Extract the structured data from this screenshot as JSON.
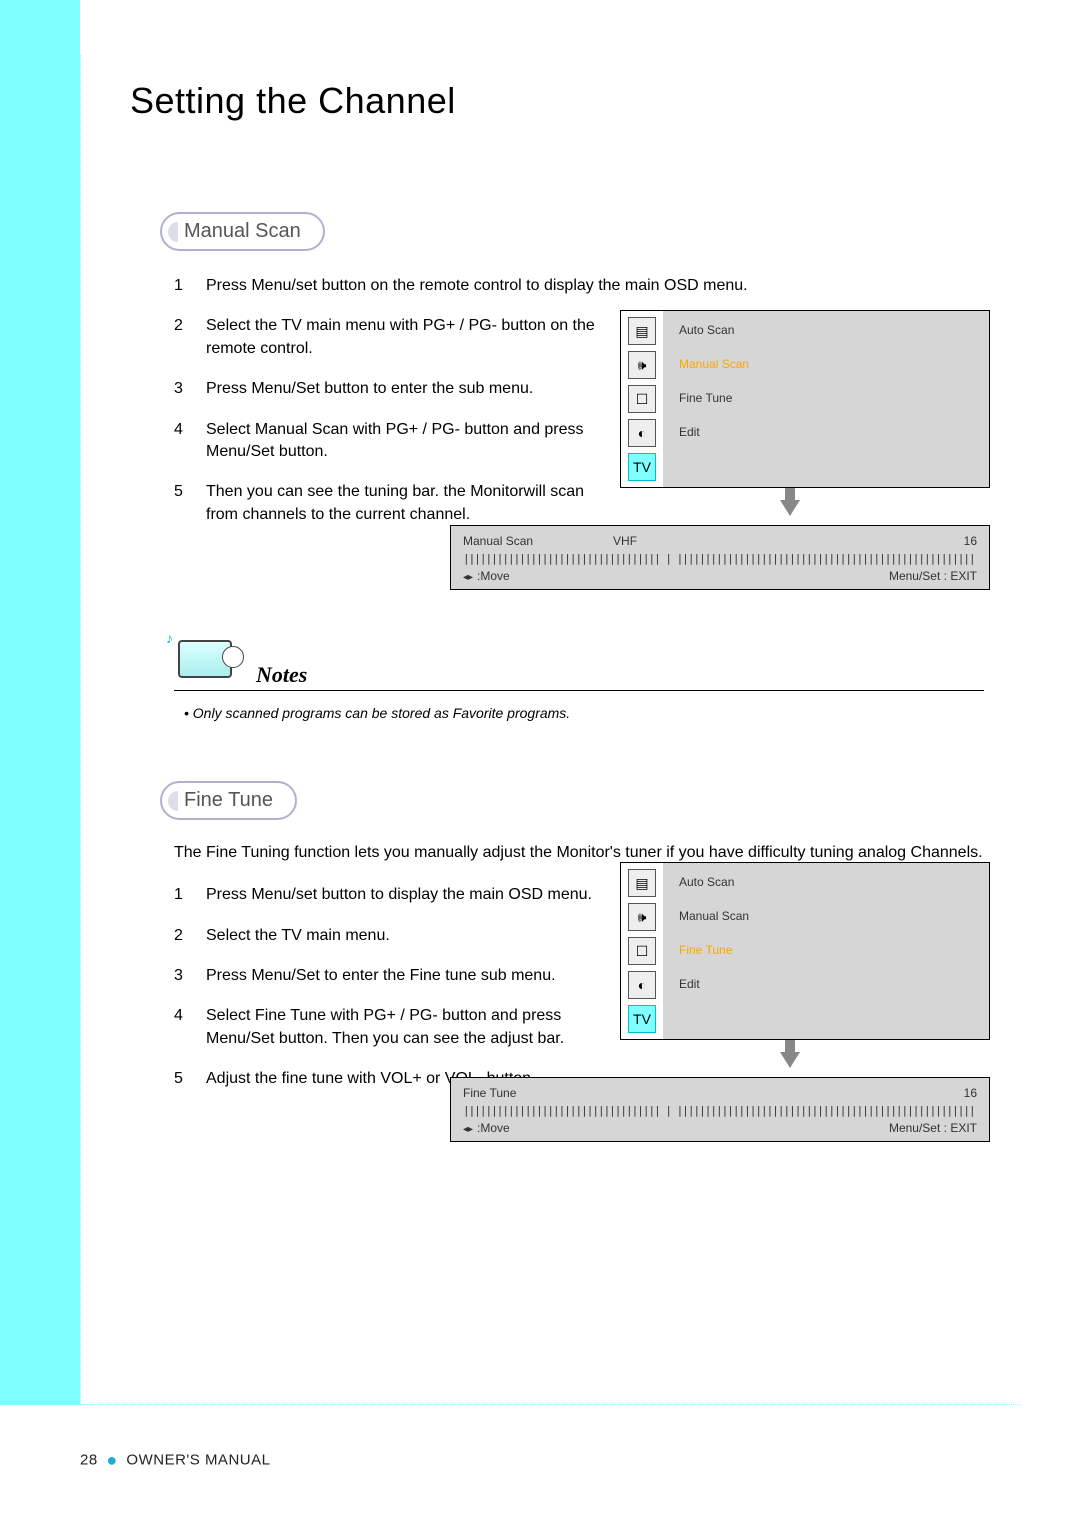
{
  "page": {
    "title": "Setting the Channel",
    "number": "28",
    "footer_label": "OWNER'S MANUAL"
  },
  "section1": {
    "heading": "Manual Scan",
    "steps": [
      "Press Menu/set button on the remote control to display the main OSD menu.",
      "Select the TV main menu with PG+ / PG- button on the remote control.",
      "Press Menu/Set button to enter the sub menu.",
      "Select Manual Scan with PG+ / PG- button and press Menu/Set button.",
      "Then you can see the tuning bar. the Monitorwill scan from channels to the current channel."
    ],
    "osd": {
      "items": [
        "Auto Scan",
        "Manual Scan",
        "Fine Tune",
        "Edit"
      ],
      "highlight_index": 1
    },
    "status": {
      "label": "Manual Scan",
      "band": "VHF",
      "value": "16",
      "move": ":Move",
      "exit": "Menu/Set : EXIT"
    }
  },
  "notes": {
    "title": "Notes",
    "bullet": "• Only scanned programs can be stored as Favorite programs."
  },
  "section2": {
    "heading": "Fine Tune",
    "intro": "The Fine Tuning function lets you manually adjust the Monitor's tuner if you have difficulty tuning analog Channels.",
    "steps": [
      "Press Menu/set button to display the main OSD menu.",
      "Select the TV main menu.",
      "Press Menu/Set to enter the Fine tune sub menu.",
      "Select Fine Tune with PG+ / PG- button and press Menu/Set button. Then you can see the adjust bar.",
      "Adjust the fine tune with VOL+ or VOL- button."
    ],
    "osd": {
      "items": [
        "Auto Scan",
        "Manual Scan",
        "Fine Tune",
        "Edit"
      ],
      "highlight_index": 2
    },
    "status": {
      "label": "Fine Tune",
      "value": "16",
      "move": ":Move",
      "exit": "Menu/Set : EXIT"
    }
  },
  "ticks": "||||||||||||||||||||||||||||||||||| | |||||||||||||||||||||||||||||||||||||||||||||||||||||||||||||"
}
